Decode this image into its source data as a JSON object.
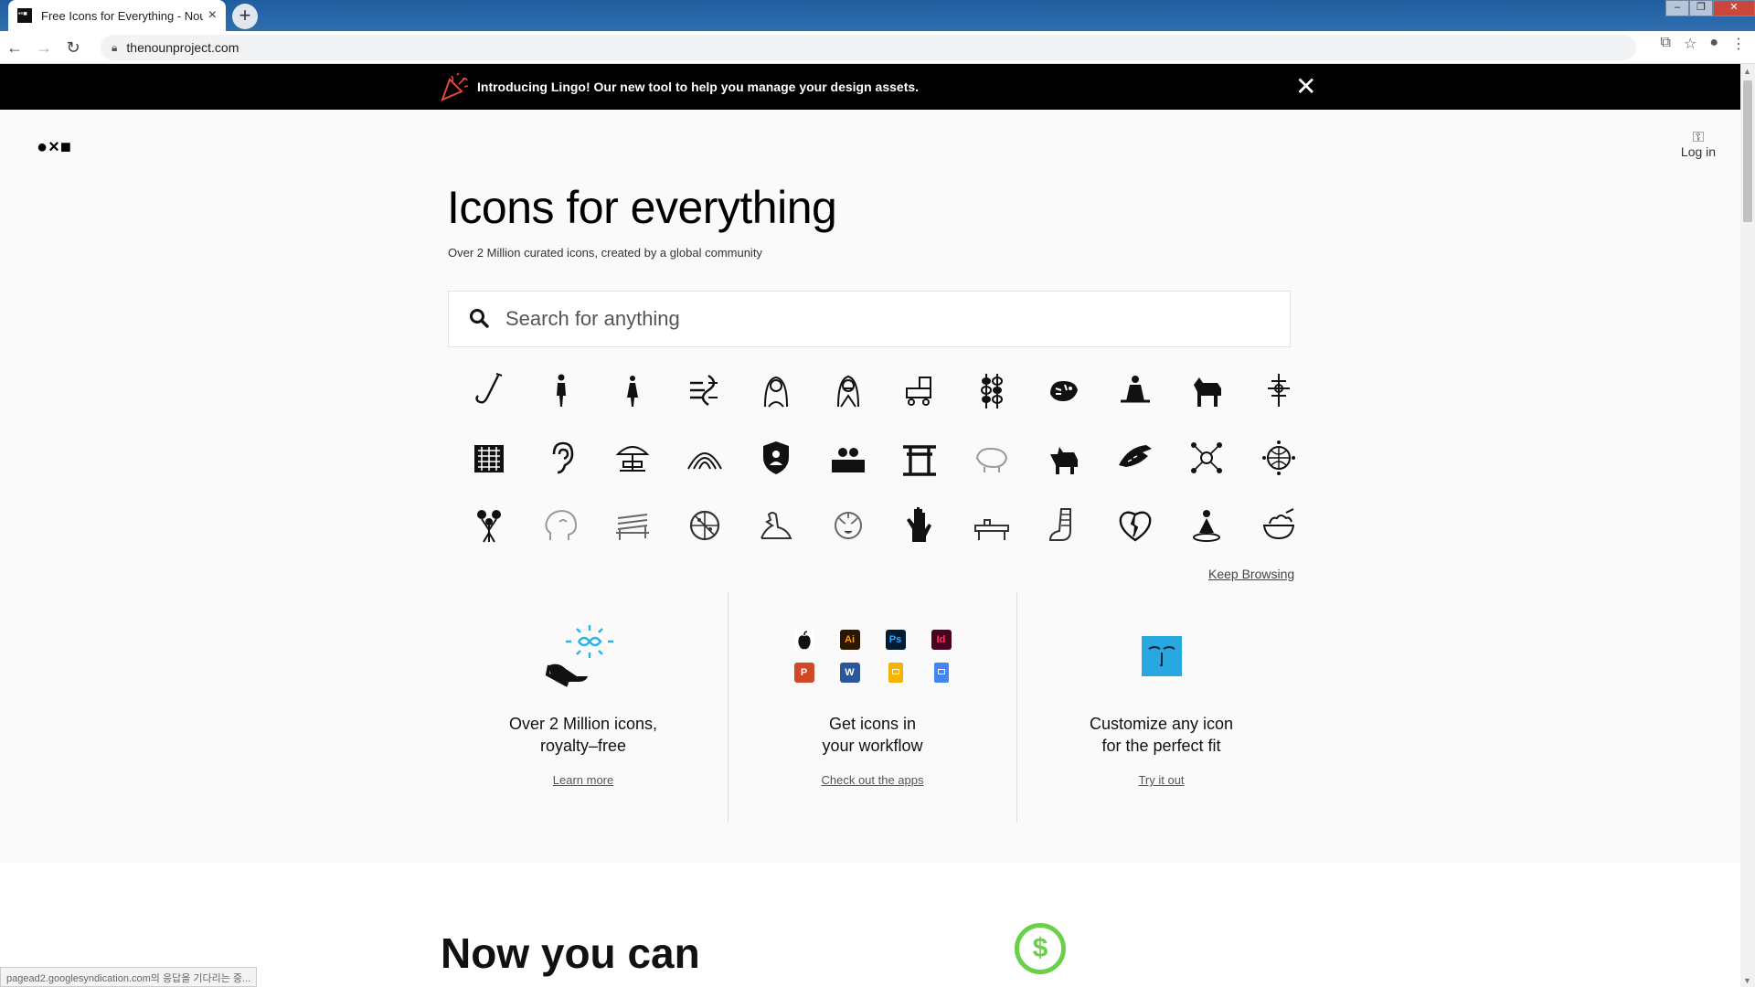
{
  "browser": {
    "tab_title": "Free Icons for Everything - Nou",
    "tab_close": "×",
    "new_tab": "+",
    "url": "thenounproject.com",
    "status_text": "pagead2.googlesyndication.com의 응답을 기다리는 중..."
  },
  "banner": {
    "text": "Introducing Lingo! Our new tool to help you manage your design assets.",
    "close": "✕"
  },
  "header": {
    "logo": "●×■",
    "login_label": "Log in"
  },
  "hero": {
    "title": "Icons for everything",
    "subtitle": "Over 2 Million curated icons, created by a global community",
    "search_placeholder": "Search for anything"
  },
  "keep_browsing": "Keep Browsing",
  "features": [
    {
      "heading_line1": "Over 2 Million icons,",
      "heading_line2": "royalty–free",
      "link": "Learn more"
    },
    {
      "heading_line1": "Get icons in",
      "heading_line2": "your workflow",
      "link": "Check out the apps"
    },
    {
      "heading_line1": "Customize any icon",
      "heading_line2": "for the perfect fit",
      "link": "Try it out"
    }
  ],
  "apps": [
    {
      "label": "",
      "icon": "apple-icon",
      "bg": "#ffffff",
      "fg": "#000000"
    },
    {
      "label": "Ai",
      "icon": "illustrator-icon",
      "bg": "#2b1700",
      "fg": "#ff9a00"
    },
    {
      "label": "Ps",
      "icon": "photoshop-icon",
      "bg": "#001d34",
      "fg": "#31a8ff"
    },
    {
      "label": "Id",
      "icon": "indesign-icon",
      "bg": "#49021f",
      "fg": "#ff3366"
    },
    {
      "label": "P",
      "icon": "powerpoint-icon",
      "bg": "#d24726",
      "fg": "#ffffff"
    },
    {
      "label": "W",
      "icon": "word-icon",
      "bg": "#2b579a",
      "fg": "#ffffff"
    },
    {
      "label": "",
      "icon": "google-slides-icon",
      "bg": "#f4b400",
      "fg": "#ffffff"
    },
    {
      "label": "",
      "icon": "google-docs-icon",
      "bg": "#4285f4",
      "fg": "#ffffff"
    }
  ],
  "lower": {
    "heading": "Now you can",
    "badge": "$"
  },
  "colors": {
    "banner_bg": "#000000",
    "customize_blue": "#29a7e1",
    "accent_green": "#6ad04a"
  }
}
